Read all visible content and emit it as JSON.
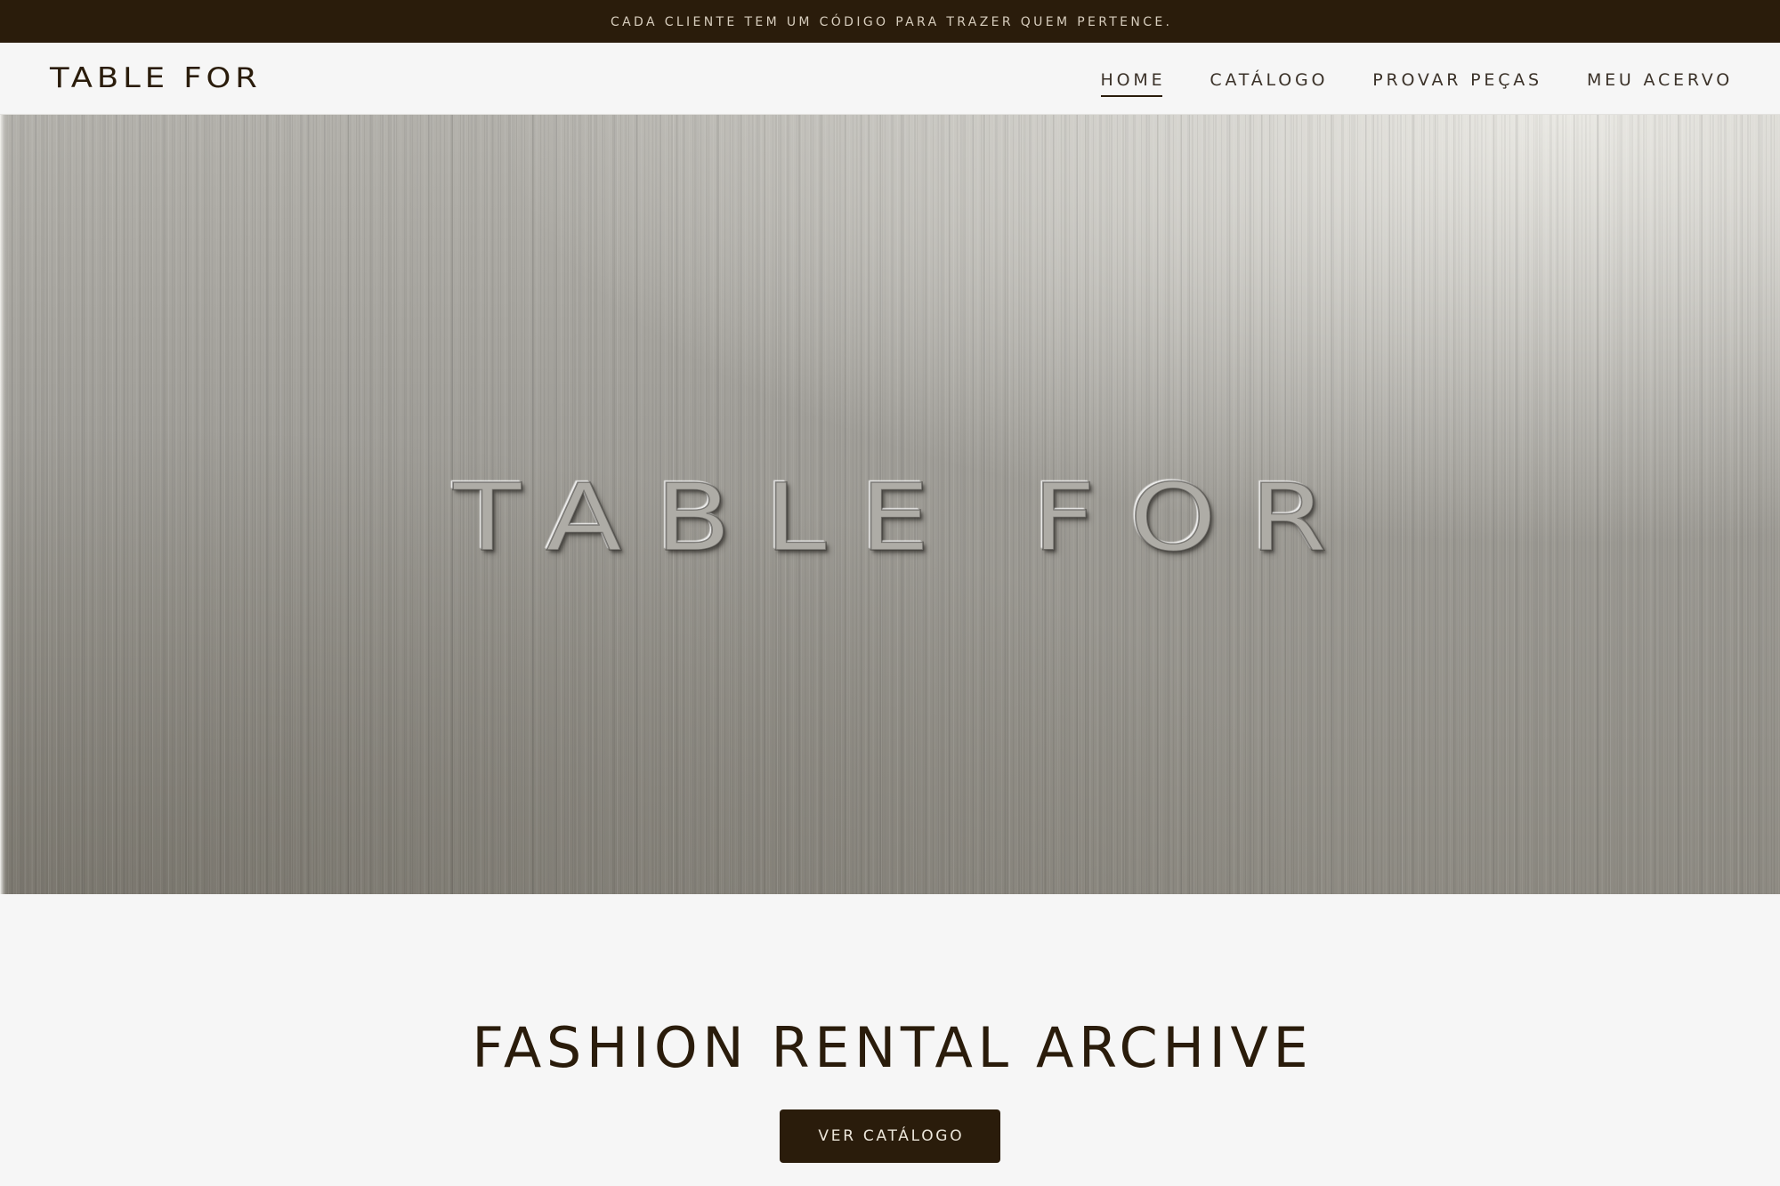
{
  "announcement": {
    "text": "CADA CLIENTE TEM UM CÓDIGO PARA TRAZER QUEM PERTENCE."
  },
  "header": {
    "logo": "TABLE FOR",
    "nav": [
      {
        "label": "HOME",
        "active": true
      },
      {
        "label": "CATÁLOGO",
        "active": false
      },
      {
        "label": "PROVAR PEÇAS",
        "active": false
      },
      {
        "label": "MEU ACERVO",
        "active": false
      }
    ]
  },
  "hero": {
    "embossed_logo": "TABLE FOR"
  },
  "intro": {
    "title": "FASHION RENTAL ARCHIVE",
    "cta_label": "VER CATÁLOGO"
  },
  "colors": {
    "brand_dark": "#2a1c0b",
    "page_bg": "#f6f6f6",
    "announcement_text": "#d7cdbd",
    "nav_text": "#3b3229"
  }
}
